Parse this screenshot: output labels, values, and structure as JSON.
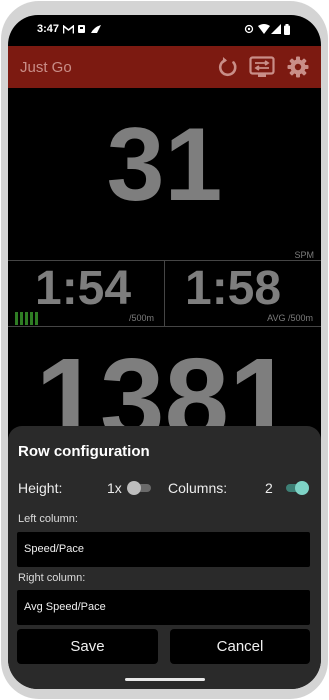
{
  "status_bar": {
    "time": "3:47"
  },
  "app_bar": {
    "title": "Just Go",
    "icons": [
      "refresh-icon",
      "screen-swap-icon",
      "gear-icon"
    ]
  },
  "metrics": {
    "stroke_rate": {
      "value": "31",
      "unit": "SPM"
    },
    "pace": {
      "value": "1:54",
      "unit": "/500m"
    },
    "avg_pace": {
      "value": "1:58",
      "unit": "AVG /500m"
    },
    "distance": {
      "value": "1381"
    },
    "force_bars_color": "#2f7d24"
  },
  "sheet": {
    "title": "Row configuration",
    "height_label": "Height:",
    "height_value": "1x",
    "height_toggle_on": false,
    "columns_label": "Columns:",
    "columns_value": "2",
    "columns_toggle_on": true,
    "left_column_label": "Left column:",
    "left_column_value": "Speed/Pace",
    "right_column_label": "Right column:",
    "right_column_value": "Avg Speed/Pace",
    "save_label": "Save",
    "cancel_label": "Cancel"
  },
  "colors": {
    "app_bar": "#7c1a11",
    "toggle_on": "#7ed3c6",
    "toggle_off": "#bdbdbd"
  }
}
